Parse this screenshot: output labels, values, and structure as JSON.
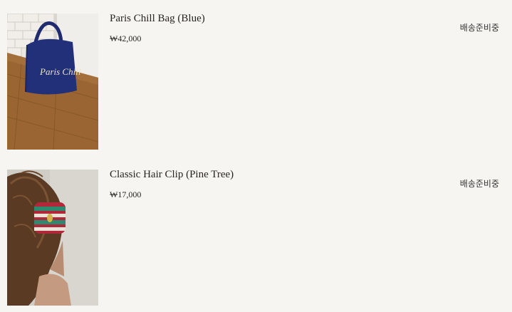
{
  "orders": [
    {
      "name": "Paris Chill Bag (Blue)",
      "price": "₩42,000",
      "status": "배송준비중",
      "thumbnail_icon": "bag-photo",
      "print_text": "Paris Chill"
    },
    {
      "name": "Classic Hair Clip (Pine Tree)",
      "price": "₩17,000",
      "status": "배송준비중",
      "thumbnail_icon": "hair-clip-photo"
    }
  ],
  "colors": {
    "background": "#f6f5f2",
    "bag_blue": "#22307a",
    "floor_wood": "#9a6532"
  }
}
